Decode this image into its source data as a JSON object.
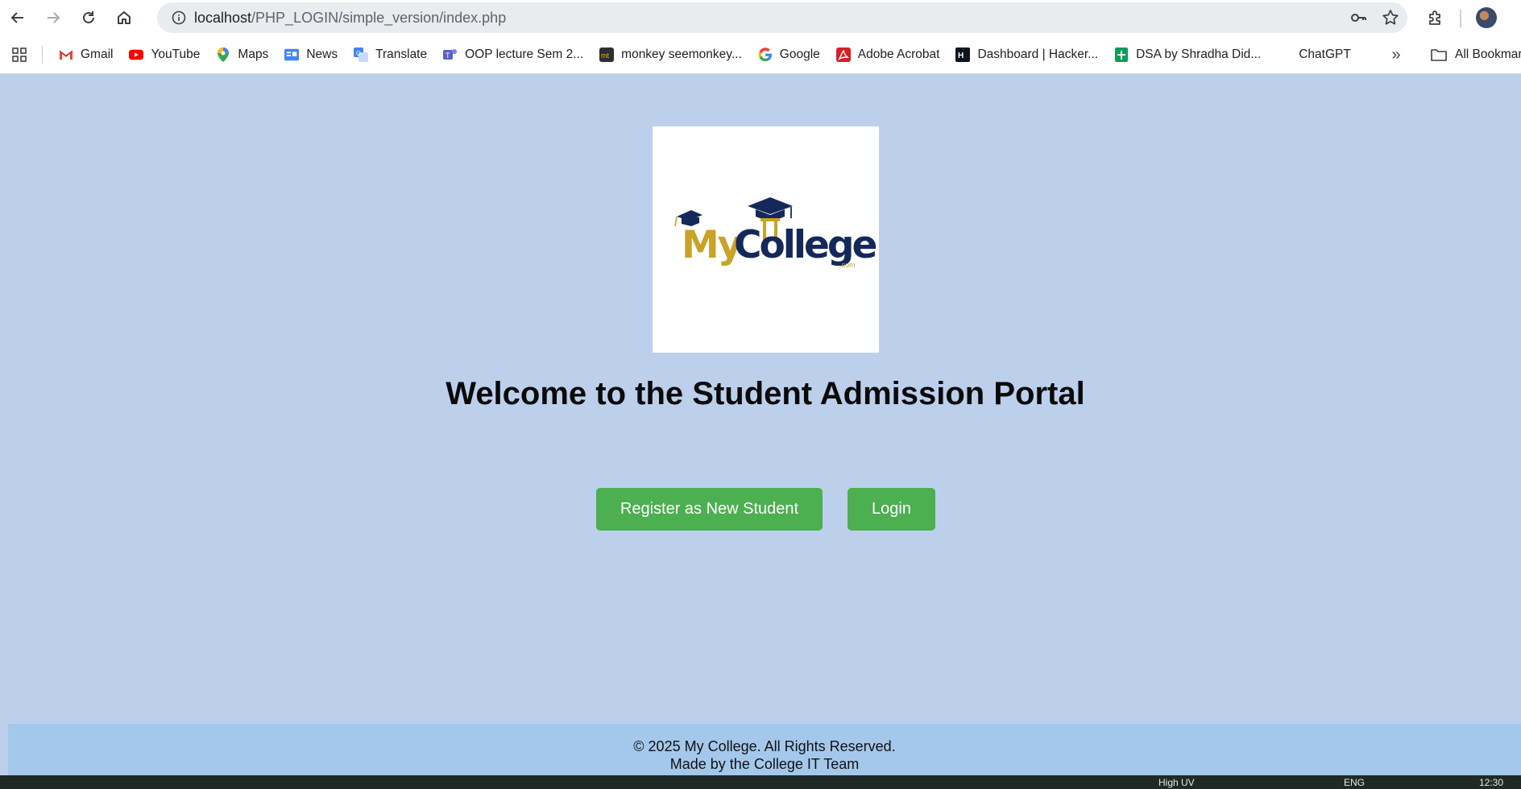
{
  "browser": {
    "url_host": "localhost",
    "url_path": "/PHP_LOGIN/simple_version/index.php",
    "bookmarks": [
      {
        "label": "Gmail",
        "icon": "gmail-icon"
      },
      {
        "label": "YouTube",
        "icon": "youtube-icon"
      },
      {
        "label": "Maps",
        "icon": "maps-icon"
      },
      {
        "label": "News",
        "icon": "news-icon"
      },
      {
        "label": "Translate",
        "icon": "translate-icon"
      },
      {
        "label": "OOP lecture Sem 2...",
        "icon": "teams-icon"
      },
      {
        "label": "monkey seemonkey...",
        "icon": "monkeytype-icon"
      },
      {
        "label": "Google",
        "icon": "google-icon"
      },
      {
        "label": "Adobe Acrobat",
        "icon": "acrobat-icon"
      },
      {
        "label": "Dashboard | Hacker...",
        "icon": "hackerrank-icon"
      },
      {
        "label": "DSA by Shradha Did...",
        "icon": "sheets-icon"
      },
      {
        "label": "ChatGPT",
        "icon": "chatgpt-icon"
      }
    ],
    "all_bookmarks_label": "All Bookmar",
    "more_label": "»"
  },
  "page": {
    "logo_text_my": "My",
    "logo_text_college": "College",
    "logo_text_com": ".com",
    "heading": "Welcome to the Student Admission Portal",
    "register_button": "Register as New Student",
    "login_button": "Login"
  },
  "footer": {
    "line1": "© 2025 My College. All Rights Reserved.",
    "line2": "Made by the College IT Team"
  },
  "taskbar": {
    "item_a": "High UV",
    "item_b": "ENG",
    "item_c": "12:30"
  },
  "colors": {
    "page_background": "#bcd0ec",
    "footer_background": "#a4c8ec",
    "button_green": "#4caf50",
    "logo_gold": "#c9a227",
    "logo_navy": "#14285a"
  }
}
